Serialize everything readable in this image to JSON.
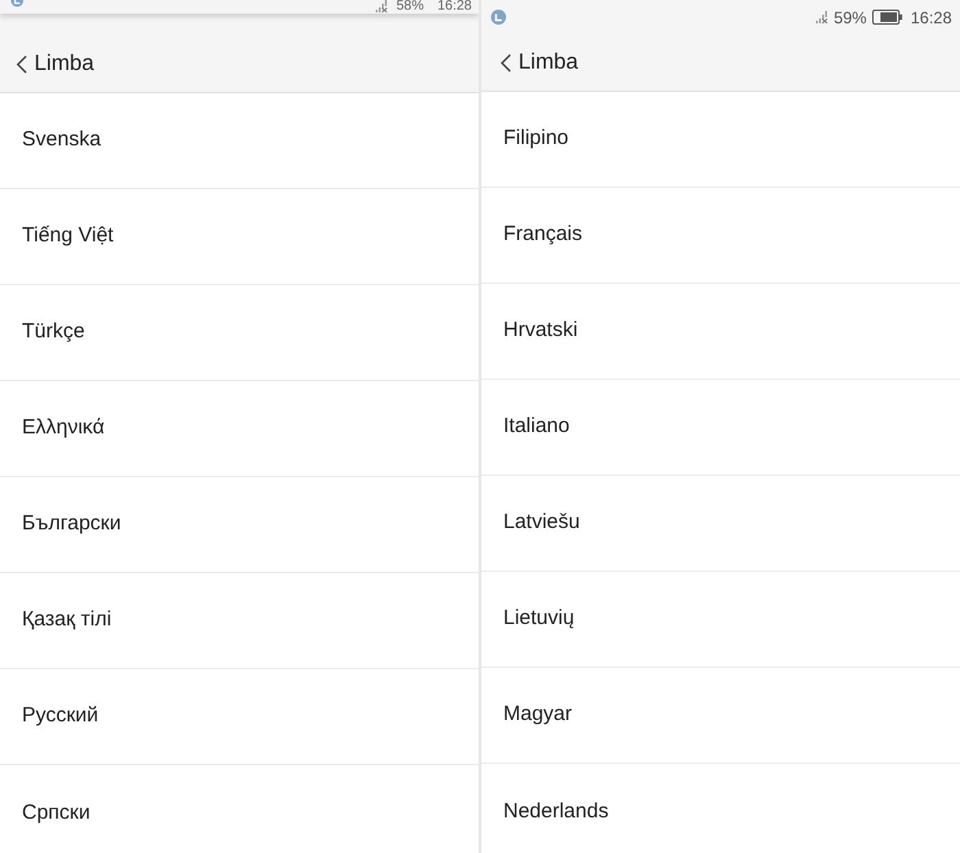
{
  "screens": [
    {
      "status_bar": {
        "kind": "clipped",
        "battery": "58%",
        "time": "16:28"
      },
      "header": {
        "title": "Limba"
      },
      "languages": [
        "Svenska",
        "Tiếng Việt",
        "Türkçe",
        "Ελληνικά",
        "Български",
        "Қазақ тілі",
        "Русский",
        "Српски"
      ]
    },
    {
      "status_bar": {
        "kind": "full",
        "battery": "59%",
        "time": "16:28"
      },
      "header": {
        "title": "Limba"
      },
      "languages": [
        "Filipino",
        "Français",
        "Hrvatski",
        "Italiano",
        "Latviešu",
        "Lietuvių",
        "Magyar",
        "Nederlands"
      ]
    }
  ]
}
